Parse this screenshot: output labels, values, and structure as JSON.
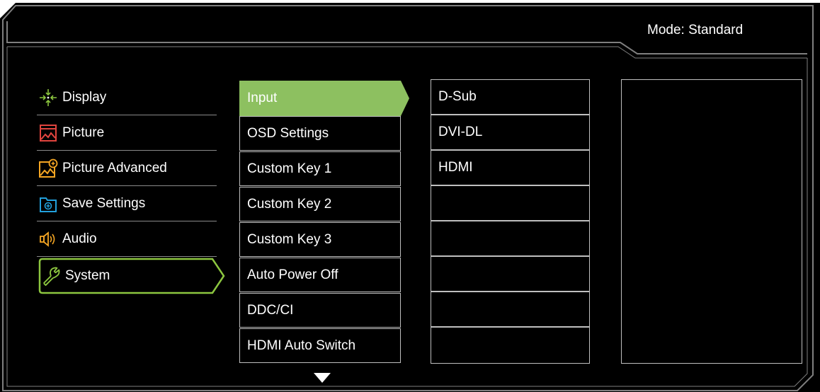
{
  "header": {
    "mode_label": "Mode: Standard"
  },
  "left_menu": {
    "items": [
      {
        "label": "Display",
        "icon": "display-icon",
        "selected": false
      },
      {
        "label": "Picture",
        "icon": "picture-icon",
        "selected": false
      },
      {
        "label": "Picture Advanced",
        "icon": "picture-advanced-icon",
        "selected": false
      },
      {
        "label": "Save Settings",
        "icon": "save-settings-icon",
        "selected": false
      },
      {
        "label": "Audio",
        "icon": "audio-icon",
        "selected": false
      },
      {
        "label": "System",
        "icon": "system-wrench-icon",
        "selected": true
      }
    ]
  },
  "submenu": {
    "items": [
      {
        "label": "Input",
        "active": true
      },
      {
        "label": "OSD Settings",
        "active": false
      },
      {
        "label": "Custom Key 1",
        "active": false
      },
      {
        "label": "Custom Key 2",
        "active": false
      },
      {
        "label": "Custom Key 3",
        "active": false
      },
      {
        "label": "Auto Power Off",
        "active": false
      },
      {
        "label": "DDC/CI",
        "active": false
      },
      {
        "label": "HDMI Auto Switch",
        "active": false
      }
    ],
    "more_indicator": "scroll-down-arrow-icon"
  },
  "options": {
    "items": [
      "D-Sub",
      "DVI-DL",
      "HDMI",
      "",
      "",
      "",
      "",
      ""
    ]
  },
  "colors": {
    "background": "#000000",
    "frame_border": "#7f7f7f",
    "accent_green": "#8dc060",
    "selection_outline": "#8cc63f",
    "picture_icon_red": "#e0443e",
    "save_icon_blue": "#22a0dc",
    "audio_icon_orange": "#f5a623",
    "text": "#ffffff"
  }
}
